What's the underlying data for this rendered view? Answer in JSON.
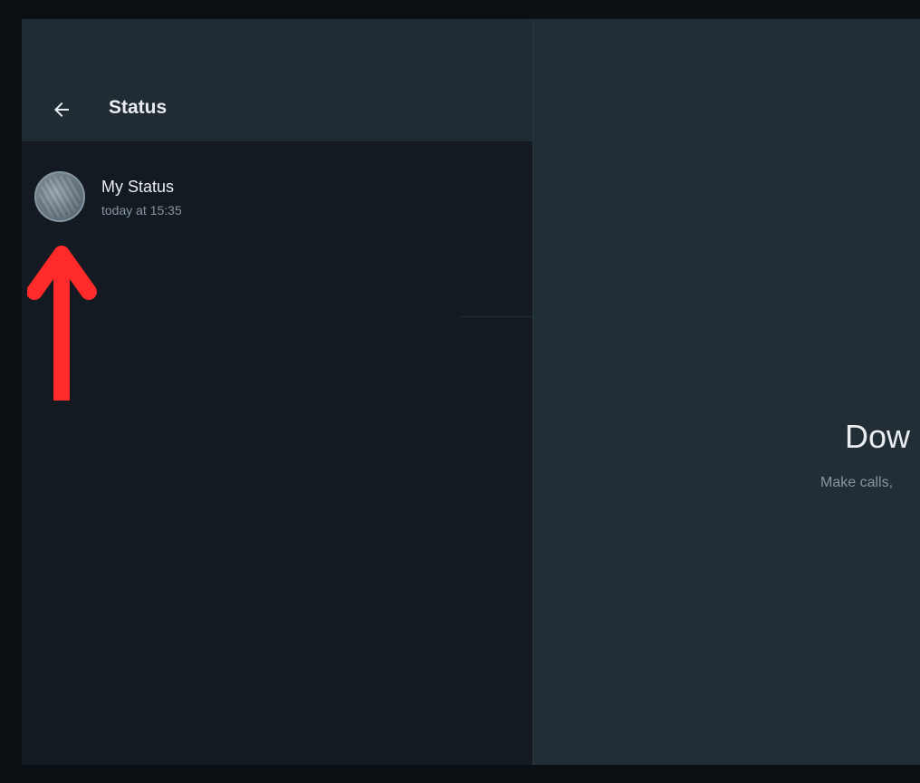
{
  "header": {
    "title": "Status",
    "back_icon": "arrow-left-icon"
  },
  "my_status": {
    "name": "My Status",
    "time": "today at 15:35",
    "avatar": "avatar-photo"
  },
  "annotation": {
    "icon": "arrow-up-icon",
    "color": "#ff2a2a"
  },
  "intro": {
    "title": "Dow",
    "subtitle": "Make calls,"
  },
  "colors": {
    "panel_bg": "#131a21",
    "header_bg": "#202c33",
    "intro_bg": "#222e35",
    "primary_text": "#e9edef",
    "secondary_text": "#8696a0"
  }
}
